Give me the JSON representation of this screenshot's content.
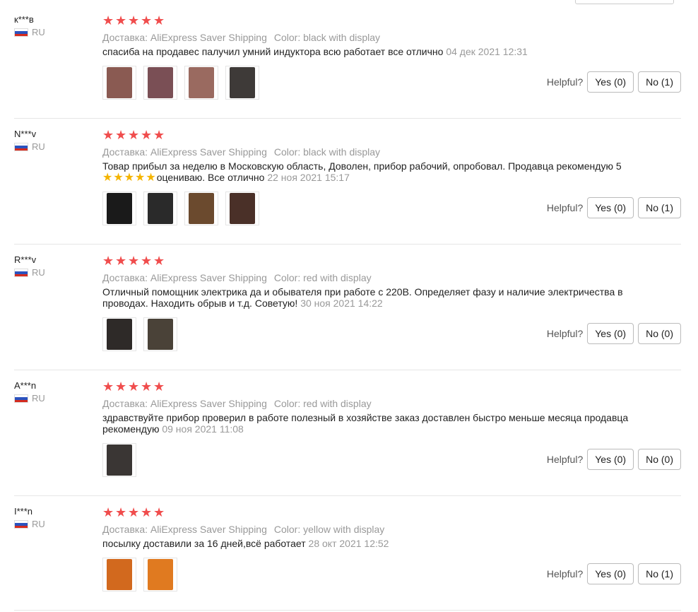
{
  "colors": {
    "star": "#f04d4d",
    "meta": "#999999",
    "inline_star": "#f4b400"
  },
  "reviews": [
    {
      "name": "к***в",
      "country": "RU",
      "stars": 5,
      "shipping": "Доставка: AliExpress Saver Shipping",
      "color": "Color: black with display",
      "text": "спасиба на продавес палучил умний индуктора всю работает все отлично",
      "date": "04 дек 2021 12:31",
      "thumbs": [
        "#8a5a52",
        "#7a4f55",
        "#9a6a60",
        "#3e3a38"
      ],
      "helpful": "Helpful?",
      "yes": "Yes (0)",
      "no": "No (1)"
    },
    {
      "name": "N***v",
      "country": "RU",
      "stars": 5,
      "shipping": "Доставка: AliExpress Saver Shipping",
      "color": "Color: black with display",
      "text_a": "Товар прибыл за неделю в Московскую область, Доволен, прибор рабочий, опробовал. Продавца рекомендую 5",
      "inline_stars": "★★★★★",
      "text_b": "оцениваю. Все отлично",
      "date": "22 ноя 2021 15:17",
      "thumbs": [
        "#1a1a1a",
        "#2a2a2a",
        "#6b4a2e",
        "#4a3028"
      ],
      "helpful": "Helpful?",
      "yes": "Yes (0)",
      "no": "No (1)"
    },
    {
      "name": "R***v",
      "country": "RU",
      "stars": 5,
      "shipping": "Доставка: AliExpress Saver Shipping",
      "color": "Color: red with display",
      "text": "Отличный помощник электрика да и обывателя при работе с 220В. Определяет фазу и наличие электричества в проводах. Находить обрыв и т.д. Советую!",
      "date": "30 ноя 2021 14:22",
      "thumbs": [
        "#2e2a28",
        "#4a4238"
      ],
      "helpful": "Helpful?",
      "yes": "Yes (0)",
      "no": "No (0)"
    },
    {
      "name": "A***n",
      "country": "RU",
      "stars": 5,
      "shipping": "Доставка: AliExpress Saver Shipping",
      "color": "Color: red with display",
      "text": "здравствуйте прибор проверил в работе полезный в хозяйстве заказ доставлен быстро меньше месяца продавца рекомендую",
      "date": "09 ноя 2021 11:08",
      "thumbs": [
        "#3a3634"
      ],
      "helpful": "Helpful?",
      "yes": "Yes (0)",
      "no": "No (0)"
    },
    {
      "name": "I***n",
      "country": "RU",
      "stars": 5,
      "shipping": "Доставка: AliExpress Saver Shipping",
      "color": "Color: yellow with display",
      "text": "посылку доставили за 16 дней,всё работает",
      "date": "28 окт 2021 12:52",
      "thumbs": [
        "#d2691e",
        "#e07a20"
      ],
      "helpful": "Helpful?",
      "yes": "Yes (0)",
      "no": "No (1)"
    }
  ]
}
